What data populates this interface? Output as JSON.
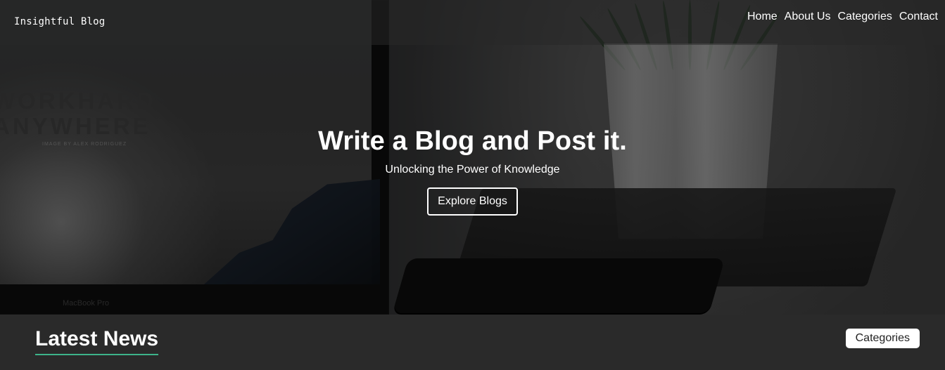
{
  "header": {
    "brand": "Insightful Blog",
    "nav": [
      "Home",
      "About Us",
      "Categories",
      "Contact"
    ]
  },
  "hero": {
    "title": "Write a Blog and Post it.",
    "subtitle": "Unlocking the Power of Knowledge",
    "button": "Explore Blogs"
  },
  "background": {
    "work_text": "WORKHARD\nANYWHERE",
    "image_credit": "IMAGE BY ALEX RODRIGUEZ",
    "laptop_brand": "MacBook Pro"
  },
  "latest": {
    "title": "Latest News",
    "button": "Categories"
  }
}
